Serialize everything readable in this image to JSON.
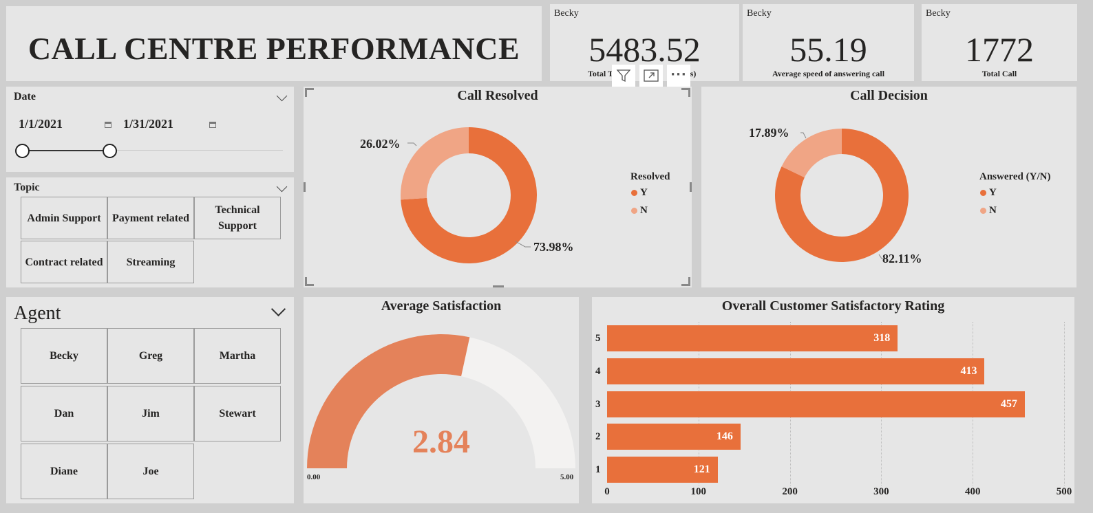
{
  "title": "CALL CENTRE PERFORMANCE",
  "colors": {
    "primary": "#e8703b",
    "secondary": "#f0a585",
    "gauge_fill": "#e4825a",
    "gauge_empty": "#f3f2f1",
    "panel": "#e6e6e6",
    "background": "#cfcfcf"
  },
  "kpis": [
    {
      "agent": "Becky",
      "value": "5483.52",
      "label_left": "Total T",
      "label_right": "ds)"
    },
    {
      "agent": "Becky",
      "value": "55.19",
      "label": "Average speed of answering call"
    },
    {
      "agent": "Becky",
      "value": "1772",
      "label": "Total Call"
    }
  ],
  "visual_header": {
    "icons": [
      "filter-icon",
      "focus-mode-icon",
      "more-options-icon"
    ],
    "more_label": "···"
  },
  "date_slicer": {
    "title": "Date",
    "start": "1/1/2021",
    "end": "1/31/2021"
  },
  "topic_slicer": {
    "title": "Topic",
    "items": [
      "Admin Support",
      "Payment related",
      "Technical Support",
      "Contract related",
      "Streaming"
    ]
  },
  "agent_slicer": {
    "title": "Agent",
    "items": [
      "Becky",
      "Greg",
      "Martha",
      "Dan",
      "Jim",
      "Stewart",
      "Diane",
      "Joe"
    ]
  },
  "call_resolved": {
    "title": "Call Resolved",
    "legend_title": "Resolved",
    "legend": [
      "Y",
      "N"
    ],
    "label_y": "73.98%",
    "label_n": "26.02%"
  },
  "call_decision": {
    "title": "Call Decision",
    "legend_title": "Answered (Y/N)",
    "legend": [
      "Y",
      "N"
    ],
    "label_y": "82.11%",
    "label_n": "17.89%"
  },
  "avg_satisfaction": {
    "title": "Average Satisfaction",
    "value": "2.84",
    "min": "0.00",
    "max": "5.00"
  },
  "rating_chart": {
    "title": "Overall Customer Satisfactory Rating"
  },
  "chart_data": [
    {
      "type": "pie",
      "title": "Call Resolved",
      "legend_title": "Resolved",
      "categories": [
        "Y",
        "N"
      ],
      "values": [
        73.98,
        26.02
      ],
      "colors": [
        "#e8703b",
        "#f0a585"
      ]
    },
    {
      "type": "pie",
      "title": "Call Decision",
      "legend_title": "Answered (Y/N)",
      "categories": [
        "Y",
        "N"
      ],
      "values": [
        82.11,
        17.89
      ],
      "colors": [
        "#e8703b",
        "#f0a585"
      ]
    },
    {
      "type": "gauge",
      "title": "Average Satisfaction",
      "value": 2.84,
      "min": 0,
      "max": 5
    },
    {
      "type": "bar",
      "orientation": "horizontal",
      "title": "Overall Customer Satisfactory Rating",
      "categories": [
        "5",
        "4",
        "3",
        "2",
        "1"
      ],
      "values": [
        318,
        413,
        457,
        146,
        121
      ],
      "xlim": [
        0,
        500
      ],
      "xticks": [
        0,
        100,
        200,
        300,
        400,
        500
      ],
      "color": "#e8703b"
    }
  ]
}
